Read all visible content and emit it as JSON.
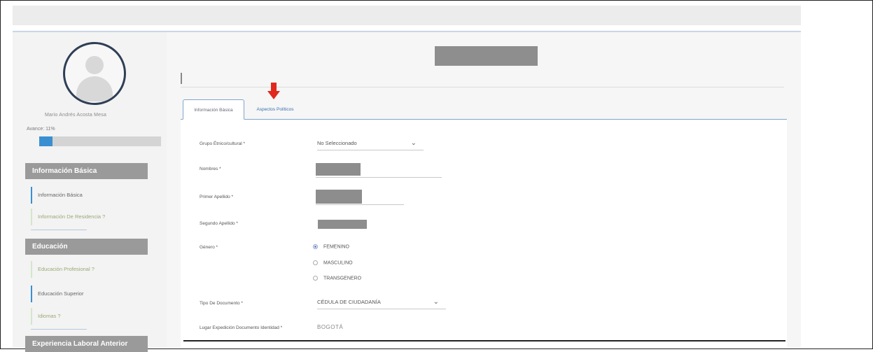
{
  "profile": {
    "name": "Mario Andrés Acosta Mesa",
    "progress_label": "Avance: 11%",
    "progress_value": 0.11
  },
  "sidebar": {
    "sections": [
      {
        "title": "Información Básica",
        "items": [
          {
            "label": "Información Básica",
            "status": "active"
          },
          {
            "label": "Información De Residencia ?",
            "status": "pending"
          }
        ]
      },
      {
        "title": "Educación",
        "items": [
          {
            "label": "Educación Profesional ?",
            "status": "pending"
          },
          {
            "label": "Educación Superior",
            "status": "active"
          },
          {
            "label": "Idiomas ?",
            "status": "pending"
          }
        ]
      },
      {
        "title": "Experiencia Laboral Anterior",
        "items": []
      }
    ]
  },
  "tabs": [
    {
      "label": "Información Básica",
      "active": true
    },
    {
      "label": "Aspectos Políticos",
      "active": false
    }
  ],
  "form": {
    "fields": [
      {
        "label": "Grupo Étnico/cultural *",
        "value": "No Seleccionado"
      },
      {
        "label": "Nombres *"
      },
      {
        "label": "Primer Apellido *"
      },
      {
        "label": "Segundo Apellido *"
      },
      {
        "label": "Género *"
      },
      {
        "label": "Tipo De Documento *",
        "value": "CÉDULA DE CIUDADANÍA"
      },
      {
        "label": "Lugar Expedición Documento Identidad *",
        "value": "BOGOTÁ"
      }
    ],
    "gender_options": [
      {
        "label": "FEMENINO",
        "checked": true
      },
      {
        "label": "MASCULINO",
        "checked": false
      },
      {
        "label": "TRANSGENERO",
        "checked": false
      }
    ]
  },
  "colors": {
    "accent": "#3a8fd0",
    "section_header": "#9a9a9a",
    "arrow": "#e0281f"
  }
}
